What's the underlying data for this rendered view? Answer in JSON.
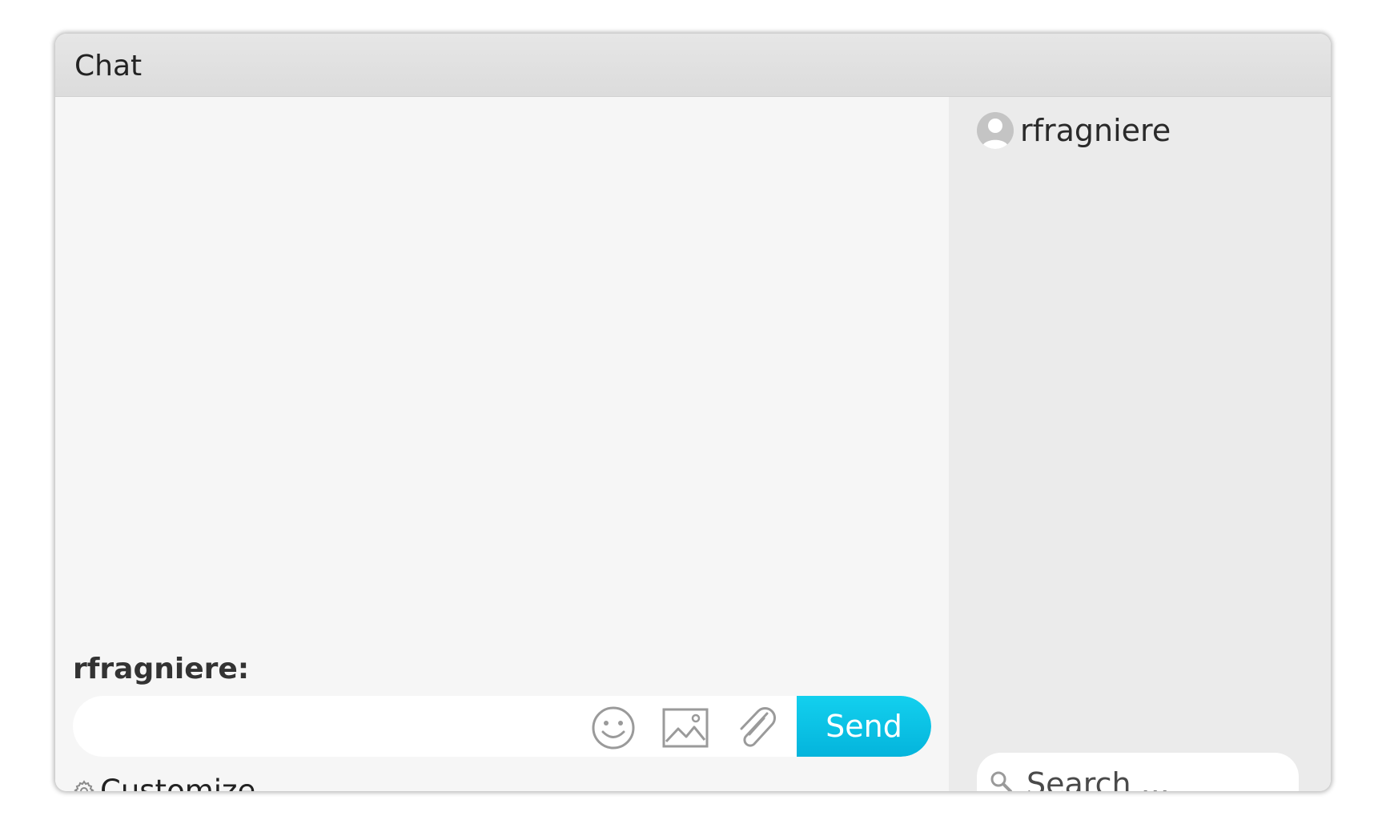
{
  "window": {
    "title": "Chat"
  },
  "sidebar": {
    "users": [
      {
        "name": "rfragniere"
      }
    ],
    "search": {
      "placeholder": "Search ...",
      "value": ""
    }
  },
  "composer": {
    "author_name": "rfragniere",
    "author_suffix": ":",
    "input_value": "",
    "send_label": "Send"
  },
  "footer": {
    "customize_label": "Customize"
  },
  "colors": {
    "send_button": "#0ac2e6",
    "titlebar": "#dedede",
    "sidebar_bg": "#ebebeb",
    "main_bg": "#f6f6f6"
  },
  "icons": {
    "avatar": "user-avatar-icon",
    "emoji": "smiley-icon",
    "image": "image-icon",
    "attach": "paperclip-icon",
    "settings": "gear-icon",
    "search": "magnifier-icon"
  }
}
